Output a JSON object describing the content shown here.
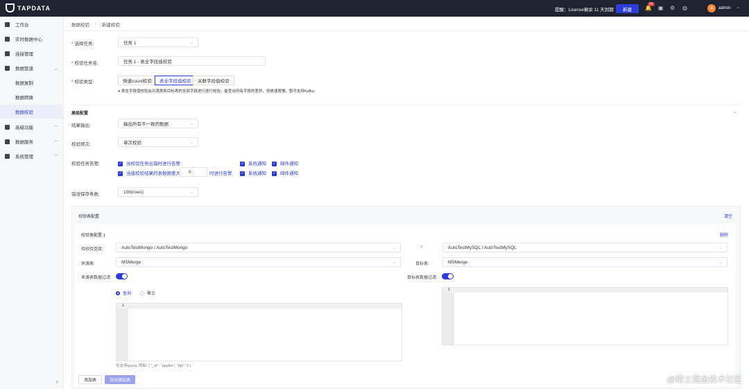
{
  "header": {
    "logo": "TAPDATA",
    "license": "提醒：License剩余 11 天到期",
    "new_button": "新建",
    "badge_count": "34",
    "user": "admin",
    "avatar_letter": "a"
  },
  "sidebar": {
    "items": [
      {
        "label": "工作台"
      },
      {
        "label": "实时数据中心"
      },
      {
        "label": "连接管理"
      },
      {
        "label": "数据管道"
      },
      {
        "label": "数据复制"
      },
      {
        "label": "数据转换"
      },
      {
        "label": "数据校验"
      },
      {
        "label": "高级功能"
      },
      {
        "label": "数据服务"
      },
      {
        "label": "系统管理"
      }
    ]
  },
  "breadcrumb": [
    "数据校验",
    "新建校验"
  ],
  "form": {
    "task_label": "选择任务:",
    "task_value": "任务 1",
    "name_label": "校验任务名:",
    "name_value": "任务 1 - 表全字段值校验",
    "type_label": "校验类型:",
    "types": [
      "快速count校验",
      "表全字段值校验",
      "关联字段值校验"
    ],
    "type_hint": "表全字段值校验会对源表和目标表的全部字段进行逐行校验，能查出所有字段的差异，但是速度慢。暂不支持Kafka",
    "advanced_title": "高级配置",
    "output_label": "结果输出:",
    "output_value": "输出所有不一致的数据",
    "freq_label": "校验频次:",
    "freq_value": "单次校验",
    "alarm_label": "校验任务告警:",
    "alarm1": "当校验任务出错时进行告警",
    "alarm2_pre": "当值校验结果的表数据差大于",
    "alarm2_value": "0",
    "alarm2_post": "时进行告警",
    "sys_notify": "系统通知",
    "mail_notify": "邮件通知",
    "errors_label": "错误保存条数:",
    "errors_value": "100(rows)"
  },
  "panel": {
    "title": "校验表配置",
    "clear": "清空",
    "card_title": "校验表配置 1",
    "delete": "删除",
    "conn_label": "待校验连接:",
    "source_conn": "AutoTestMongo / AutoTestMongo",
    "arrow": ">",
    "target_conn": "AutoTestMySQL / AutoTestMySQL",
    "source_table_label": "来源表:",
    "source_table": "MSMerge",
    "target_table_label": "目标表:",
    "target_table": "MSMerge",
    "source_filter_label": "来源表数据过滤:",
    "target_filter_label": "目标表数据过滤:",
    "radio_query": "查询",
    "radio_agg": "聚合",
    "line_no": "1",
    "hint": "仅支持query, 例如: { \"_id\": \"apples\", \"qty\": 5 }",
    "add_table": "添加表",
    "auto_add": "自动添加表"
  },
  "watermark": "@稀土掘金技术社区"
}
